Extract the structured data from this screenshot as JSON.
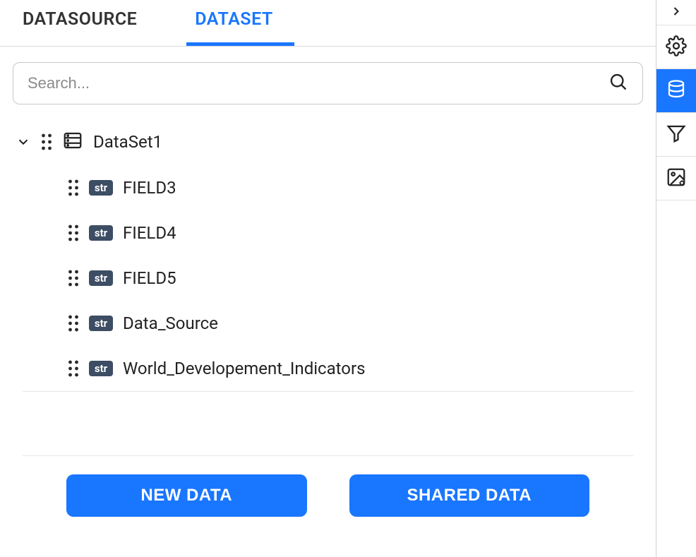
{
  "tabs": {
    "datasource": "DATASOURCE",
    "dataset": "DATASET"
  },
  "search": {
    "placeholder": "Search..."
  },
  "tree": {
    "root_label": "DataSet1",
    "type_badge": "str",
    "fields": [
      {
        "label": "FIELD3"
      },
      {
        "label": "FIELD4"
      },
      {
        "label": "FIELD5"
      },
      {
        "label": "Data_Source"
      },
      {
        "label": "World_Developement_Indicators"
      }
    ]
  },
  "buttons": {
    "new_data": "NEW DATA",
    "shared_data": "SHARED DATA"
  },
  "rail": {
    "expand": "expand",
    "settings": "settings",
    "data": "data",
    "filter": "filter",
    "image": "image-settings"
  }
}
